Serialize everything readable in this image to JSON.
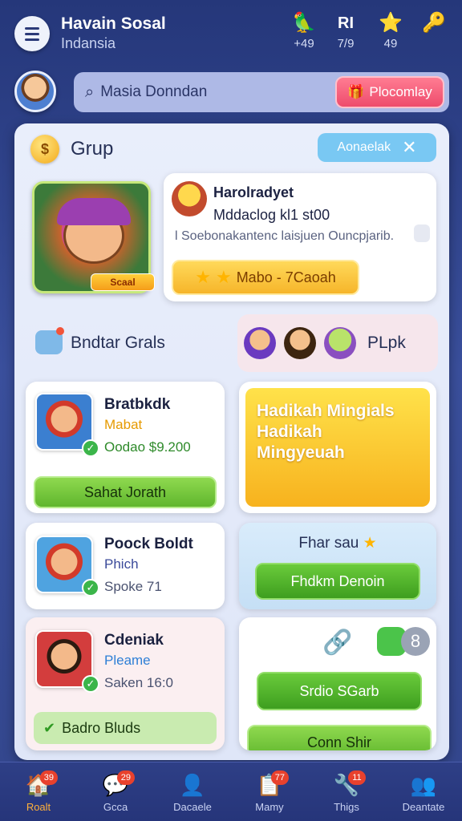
{
  "header": {
    "title": "Havain Sosal",
    "subtitle": "Indansia",
    "stats": [
      {
        "icon": "leaf-bird-icon",
        "glyph": "🦜",
        "value": "+49"
      },
      {
        "icon": "rank-icon",
        "glyph": "RI",
        "value": "7/9"
      },
      {
        "icon": "star-icon",
        "glyph": "⭐",
        "value": "49"
      },
      {
        "icon": "key-icon",
        "glyph": "🔑",
        "value": ""
      }
    ]
  },
  "search": {
    "placeholder": "Masia Donndan",
    "promo_label": "Plocomlay"
  },
  "panel": {
    "title": "Grup",
    "coin_glyph": "$",
    "close_chip_label": "Aonaelak",
    "close_glyph": "✕",
    "hero_badge": "Scaal",
    "info": {
      "name": "Harolradyet",
      "line": "Mddaclog kl1 st00",
      "desc": "l Soebonakantenc laisjuen Ouncpjarib.",
      "star_button": "Mabo - 7Caoah"
    },
    "section_title": "Bndtar Grals",
    "friends_label": "PLpk"
  },
  "tiles": [
    {
      "title": "Bratbkdk",
      "subtitle": "Mabat",
      "meta": "Oodao $9.200",
      "button": "Sahat Jorath",
      "subtitle_color": "#e69a00"
    },
    {
      "title": "Poock Boldt",
      "subtitle": "Phich",
      "meta": "Spoke 71",
      "button": "",
      "subtitle_color": "#3b4a9a"
    },
    {
      "title": "Cdeniak",
      "subtitle": "Pleame",
      "meta": "Saken 16:0",
      "button": "Badro Bluds",
      "subtitle_color": "#2e7fd6"
    }
  ],
  "promo_tile": {
    "line1": "Hadikah Mingials",
    "line2": "Hadikah",
    "line3": "Mingyeuah"
  },
  "right_tile_mid": {
    "label": "Fhar sau",
    "button": "Fhdkm Denoin"
  },
  "right_tile_bottom": {
    "badge": "8",
    "button": "Srdio SGarb",
    "button2": "Conn Shir"
  },
  "nav": [
    {
      "label": "Roalt",
      "badge": "39",
      "icon": "home-icon",
      "glyph": "🏠",
      "active": true
    },
    {
      "label": "Gcca",
      "badge": "29",
      "icon": "chat-icon",
      "glyph": "💬",
      "active": false
    },
    {
      "label": "Dacaele",
      "badge": "",
      "icon": "profile-icon",
      "glyph": "👤",
      "active": false
    },
    {
      "label": "Mamy",
      "badge": "77",
      "icon": "list-icon",
      "glyph": "📋",
      "active": false
    },
    {
      "label": "Thigs",
      "badge": "11",
      "icon": "tools-icon",
      "glyph": "🔧",
      "active": false
    },
    {
      "label": "Deantate",
      "badge": "",
      "icon": "people-icon",
      "glyph": "👥",
      "active": false
    }
  ],
  "colors": {
    "background": "#2e3f86",
    "accent_pink": "#ee4c6c",
    "accent_green": "#5fb62d",
    "accent_yellow": "#f7b21e",
    "nav_active": "#ffb03a"
  }
}
